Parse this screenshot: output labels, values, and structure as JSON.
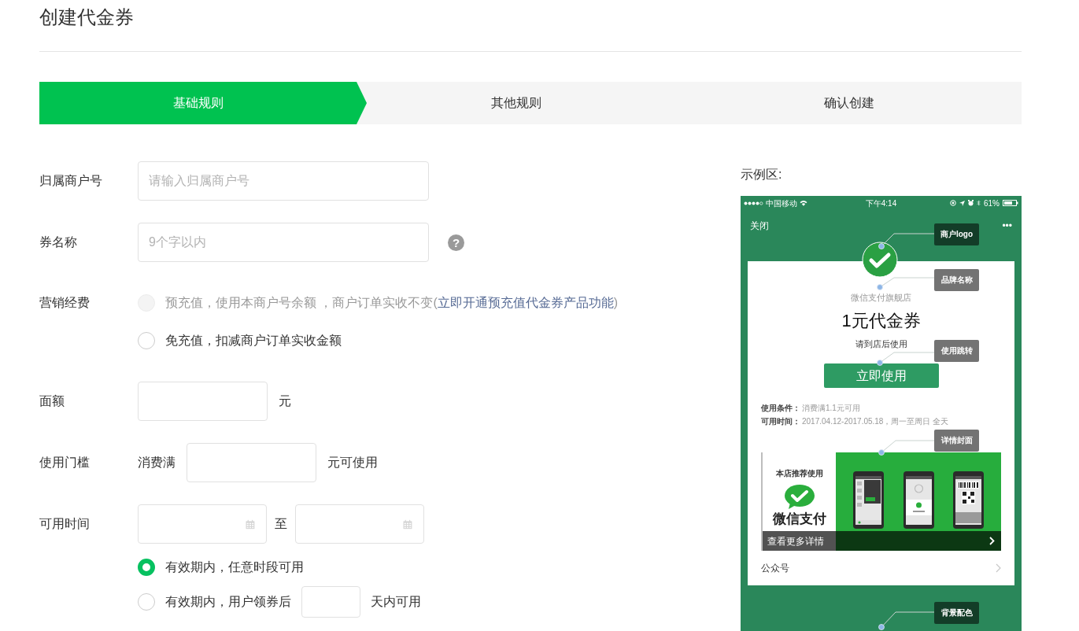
{
  "header": {
    "title": "创建代金券"
  },
  "steps": [
    {
      "label": "基础规则",
      "selected": true
    },
    {
      "label": "其他规则",
      "selected": false
    },
    {
      "label": "确认创建",
      "selected": false
    }
  ],
  "fields": [
    {
      "kind": "text",
      "label": "归属商户号",
      "placeholder": "请输入归属商户号"
    },
    {
      "kind": "text",
      "label": "券名称",
      "placeholder": "9个字以内",
      "help": "?"
    },
    {
      "kind": "radio",
      "label": "营销经费",
      "options": [
        {
          "text": "预充值，使用本商户号余额 ，商户订单实收不变(",
          "link": "立即开通预充值代金券产品功能",
          "after": ")",
          "selected": false,
          "disabled": true
        },
        {
          "text": "免充值，扣减商户订单实收金额",
          "selected": false,
          "disabled": false
        }
      ]
    },
    {
      "kind": "number",
      "label": "面额",
      "unit": "元"
    },
    {
      "kind": "number",
      "label": "使用门槛",
      "prefix": "消费满",
      "unit": "元可使用"
    },
    {
      "kind": "date_range",
      "label": "可用时间",
      "separator": "至",
      "options": [
        {
          "text": "有效期内，任意时段可用",
          "selected": true,
          "disabled": false
        },
        {
          "text": "有效期内，用户领券后",
          "input": true,
          "after": "天内可用",
          "selected": false,
          "disabled": false
        }
      ]
    }
  ],
  "preview": {
    "title": "示例区:",
    "phone": {
      "status_bar": {
        "carrier": "中国移动",
        "time": "下午4:14",
        "battery": "61%"
      },
      "nav": {
        "close": "关闭",
        "more": "•••"
      },
      "card": {
        "brand": "微信支付旗舰店",
        "title": "1元代金券",
        "subtitle": "请到店后使用",
        "button": "立即使用",
        "conditions": [
          {
            "label": "使用条件：",
            "value": "消费满1.1元可用"
          },
          {
            "label": "可用时间：",
            "value": "2017.04.12-2017.05.18，周一至周日 全天"
          }
        ],
        "cover": {
          "caption": "本店推荐使用",
          "brand": "微信支付",
          "more": "查看更多详情"
        },
        "link_row": "公众号"
      },
      "callouts": [
        "商户logo",
        "品牌名称",
        "使用跳转",
        "详情封面",
        "背景配色"
      ]
    }
  }
}
